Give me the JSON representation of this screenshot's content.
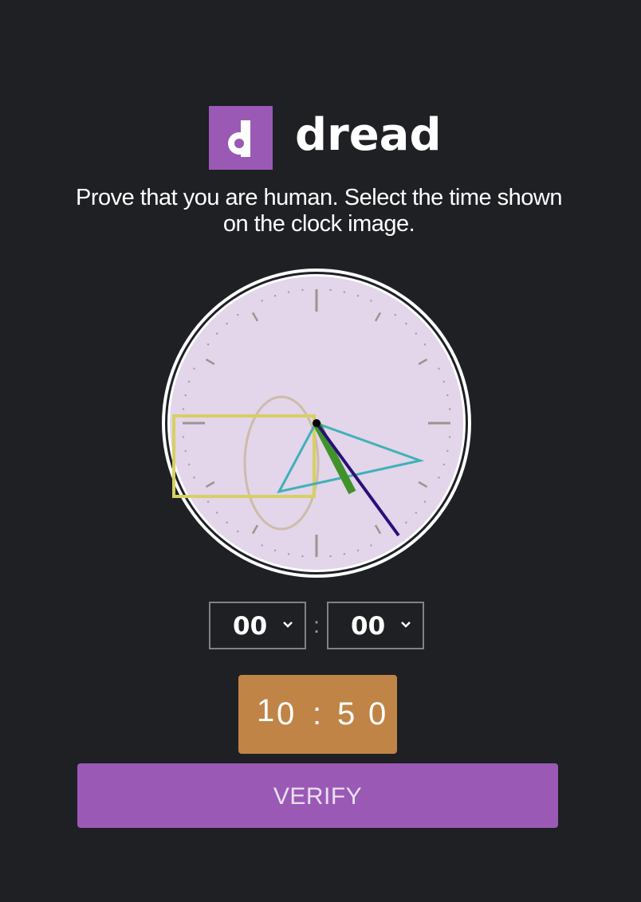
{
  "header": {
    "logo_letter": "d",
    "brand": "dread"
  },
  "instructions": "Prove that you are human. Select the time shown on the clock image.",
  "time_select": {
    "hour_value": "00",
    "separator": ":",
    "minute_value": "00"
  },
  "captcha_code": {
    "characters": [
      "1",
      "0",
      ":",
      "5",
      "0"
    ]
  },
  "verify_label": "VERIFY",
  "colors": {
    "background": "#1e2024",
    "accent": "#9b59b6",
    "code_box": "#c08447",
    "clock_face": "#e3d5ea"
  }
}
